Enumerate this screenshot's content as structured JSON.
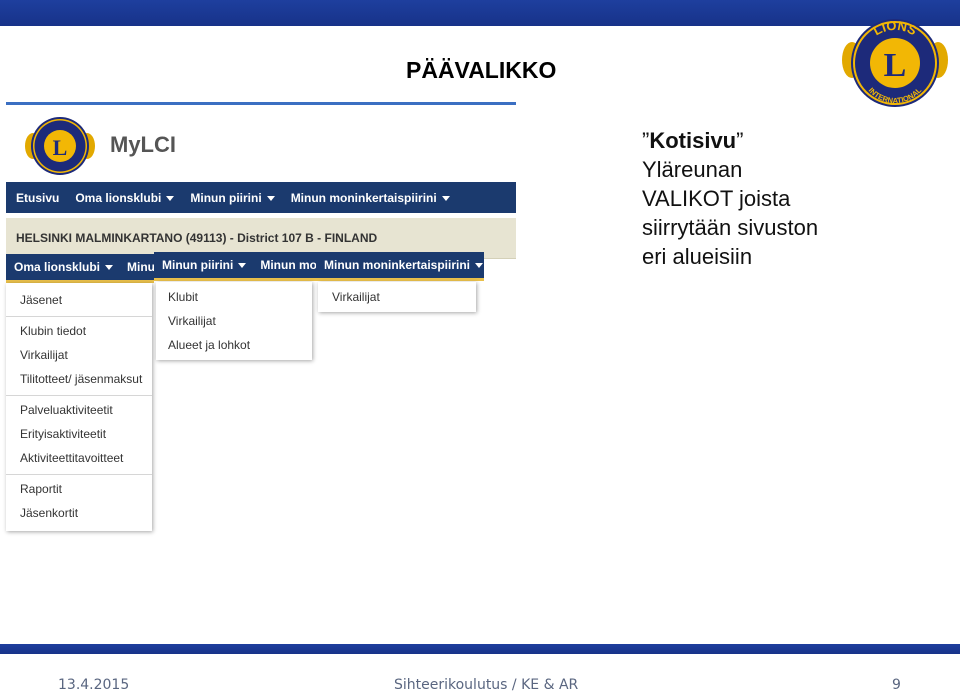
{
  "slide": {
    "title": "PÄÄVALIKKO",
    "description": {
      "highlight": "Kotisivu",
      "lines": [
        "Yläreunan",
        "VALIKOT joista",
        "siirrytään sivuston",
        "eri alueisiin"
      ]
    },
    "footer": {
      "date": "13.4.2015",
      "center": "Sihteerikoulutus / KE & AR",
      "page": "9"
    },
    "logo_text": {
      "top": "LIONS",
      "bottom": "INTERNATIONAL",
      "letter": "L"
    }
  },
  "screenshot": {
    "app_title": "MyLCI",
    "nav": [
      "Etusivu",
      "Oma lionsklubi",
      "Minun piirini",
      "Minun moninkertaispiirini"
    ],
    "club_line": "HELSINKI MALMINKARTANO (49113) - District 107 B - FINLAND",
    "dropdown_oma": {
      "header": "Oma lionsklubi",
      "next_header": "Minu",
      "groups": [
        [
          "Jäsenet"
        ],
        [
          "Klubin tiedot",
          "Virkailijat",
          "Tilitotteet/ jäsenmaksut"
        ],
        [
          "Palveluaktiviteetit",
          "Erityisaktiviteetit",
          "Aktiviteettitavoitteet"
        ],
        [
          "Raportit",
          "Jäsenkortit"
        ]
      ]
    },
    "dropdown_piiri": {
      "header": "Minun piirini",
      "next_header": "Minun mo",
      "items": [
        "Klubit",
        "Virkailijat",
        "Alueet ja lohkot"
      ]
    },
    "dropdown_moninkertais": {
      "header": "Minun moninkertaispiirini",
      "items": [
        "Virkailijat"
      ]
    }
  },
  "colors": {
    "brand_blue": "#1b3a6e",
    "slide_bar": "#1e3f9e",
    "lions_gold": "#f2b705",
    "lions_purple": "#1d2a7a"
  }
}
